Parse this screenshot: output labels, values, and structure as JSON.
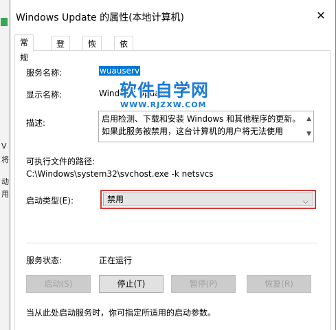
{
  "window": {
    "title": "Windows Update 的属性(本地计算机)",
    "close_glyph": "✕"
  },
  "background_fragments": [
    "V",
    "将",
    "动",
    "用"
  ],
  "tabs": [
    {
      "label": "常规",
      "active": true
    },
    {
      "label": "登录",
      "active": false
    },
    {
      "label": "恢复",
      "active": false
    },
    {
      "label": "依存关系",
      "active": false
    }
  ],
  "general": {
    "service_name_label": "服务名称:",
    "service_name_value": "wuauserv",
    "display_name_label": "显示名称:",
    "display_name_value": "Windows Update",
    "description_label": "描述:",
    "description_text": "启用检测、下载和安装 Windows 和其他程序的更新。如果此服务被禁用，这台计算机的用户将无法使用",
    "exe_path_label": "可执行文件的路径:",
    "exe_path_value": "C:\\Windows\\system32\\svchost.exe -k netsvcs",
    "startup_type_label": "启动类型(E):",
    "startup_type_value": "禁用",
    "service_status_label": "服务状态:",
    "service_status_value": "正在运行",
    "footer_text": "当从此处启动服务时，你可指定所适用的启动参数。"
  },
  "buttons": {
    "start": "启动(S)",
    "stop": "停止(T)",
    "pause": "暂停(P)",
    "resume": "恢复(R)"
  },
  "watermark": {
    "main": "软件自学网",
    "sub": "WWW.RJZXW.COM"
  },
  "icons": {
    "scroll_up": "▲",
    "scroll_down": "▼",
    "dropdown": "⌵"
  },
  "colors": {
    "selection": "#0078d7",
    "highlight_border": "#d33b3b",
    "watermark": "#1b7bd6"
  }
}
